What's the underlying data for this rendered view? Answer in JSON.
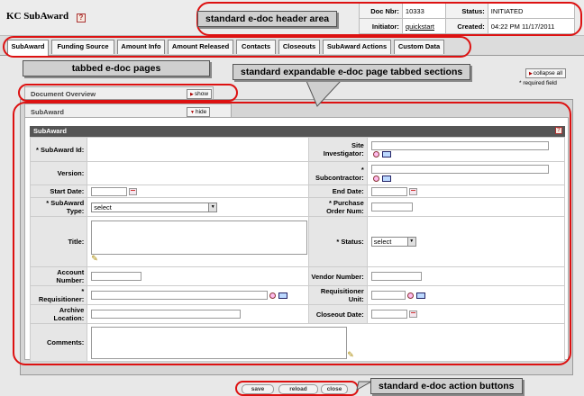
{
  "header": {
    "title": "KC SubAward",
    "help_icon": "help-icon",
    "doc_info": {
      "doc_nbr_label": "Doc Nbr:",
      "doc_nbr": "10333",
      "status_label": "Status:",
      "status": "INITIATED",
      "initiator_label": "Initiator:",
      "initiator": "quickstart",
      "created_label": "Created:",
      "created": "04:22 PM 11/17/2011"
    }
  },
  "tabs": [
    {
      "label": "SubAward",
      "active": true
    },
    {
      "label": "Funding Source"
    },
    {
      "label": "Amount Info"
    },
    {
      "label": "Amount Released"
    },
    {
      "label": "Contacts"
    },
    {
      "label": "Closeouts"
    },
    {
      "label": "SubAward Actions"
    },
    {
      "label": "Custom Data"
    }
  ],
  "collapse_all_label": "collapse all",
  "required_field_note": "* required field",
  "document_overview": {
    "title": "Document Overview",
    "button_label": "show"
  },
  "subaward_section": {
    "title": "SubAward",
    "button_label": "hide",
    "inner_title": "SubAward"
  },
  "form": {
    "subaward_id_label": "SubAward Id:",
    "site_investigator_label": "Site Investigator:",
    "version_label": "Version:",
    "subcontractor_label": "Subcontractor:",
    "start_date_label": "Start Date:",
    "end_date_label": "End Date:",
    "subaward_type_label": "SubAward Type:",
    "subaward_type_value": "select",
    "purchase_order_label": "Purchase Order Num:",
    "title_label": "Title:",
    "status_label": "Status:",
    "status_value": "select",
    "account_number_label": "Account Number:",
    "vendor_number_label": "Vendor Number:",
    "requisitioner_label": "Requisitioner:",
    "requisitioner_unit_label": "Requisitioner Unit:",
    "archive_location_label": "Archive Location:",
    "closeout_date_label": "Closeout Date:",
    "comments_label": "Comments:",
    "required_mark": "*"
  },
  "actions": {
    "save": "save",
    "reload": "reload",
    "close": "close"
  },
  "callouts": {
    "header_area": "standard e-doc header area",
    "tabbed_pages": "tabbed e-doc pages",
    "expandable_sections": "standard expandable e-doc page tabbed sections",
    "action_buttons": "standard e-doc action buttons"
  },
  "colors": {
    "annotation_oval": "#dd1111",
    "callout_bg": "#cfcfcf",
    "section_bar": "#555555"
  }
}
